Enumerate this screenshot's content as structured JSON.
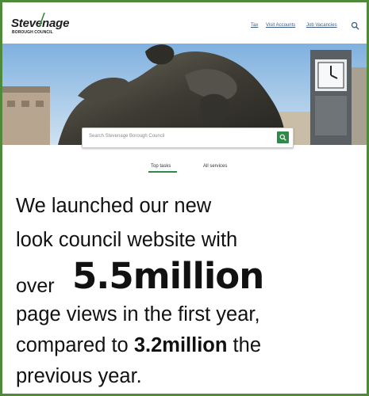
{
  "website": {
    "logo": {
      "wordmark": "Stevenage",
      "subtitle": "BOROUGH COUNCIL"
    },
    "nav": [
      "Tax",
      "Visit Accounts",
      "Job Vacancies"
    ],
    "search": {
      "placeholder": "Search Stevenage Borough Council"
    },
    "tabs": [
      {
        "label": "Top tasks",
        "selected": true
      },
      {
        "label": "All services",
        "selected": false
      }
    ],
    "colors": {
      "accent": "#2f8a4a",
      "frame": "#4f8a3a",
      "link": "#3a5d8c"
    }
  },
  "statement": {
    "line1": "We launched our new",
    "line2": "look council website with",
    "line3_prefix": "over",
    "line3_figure": "5.5million",
    "line4": "page views in the first year,",
    "line5_prefix": "compared to ",
    "line5_figure": "3.2million",
    "line5_suffix": " the",
    "line6": "previous year."
  }
}
